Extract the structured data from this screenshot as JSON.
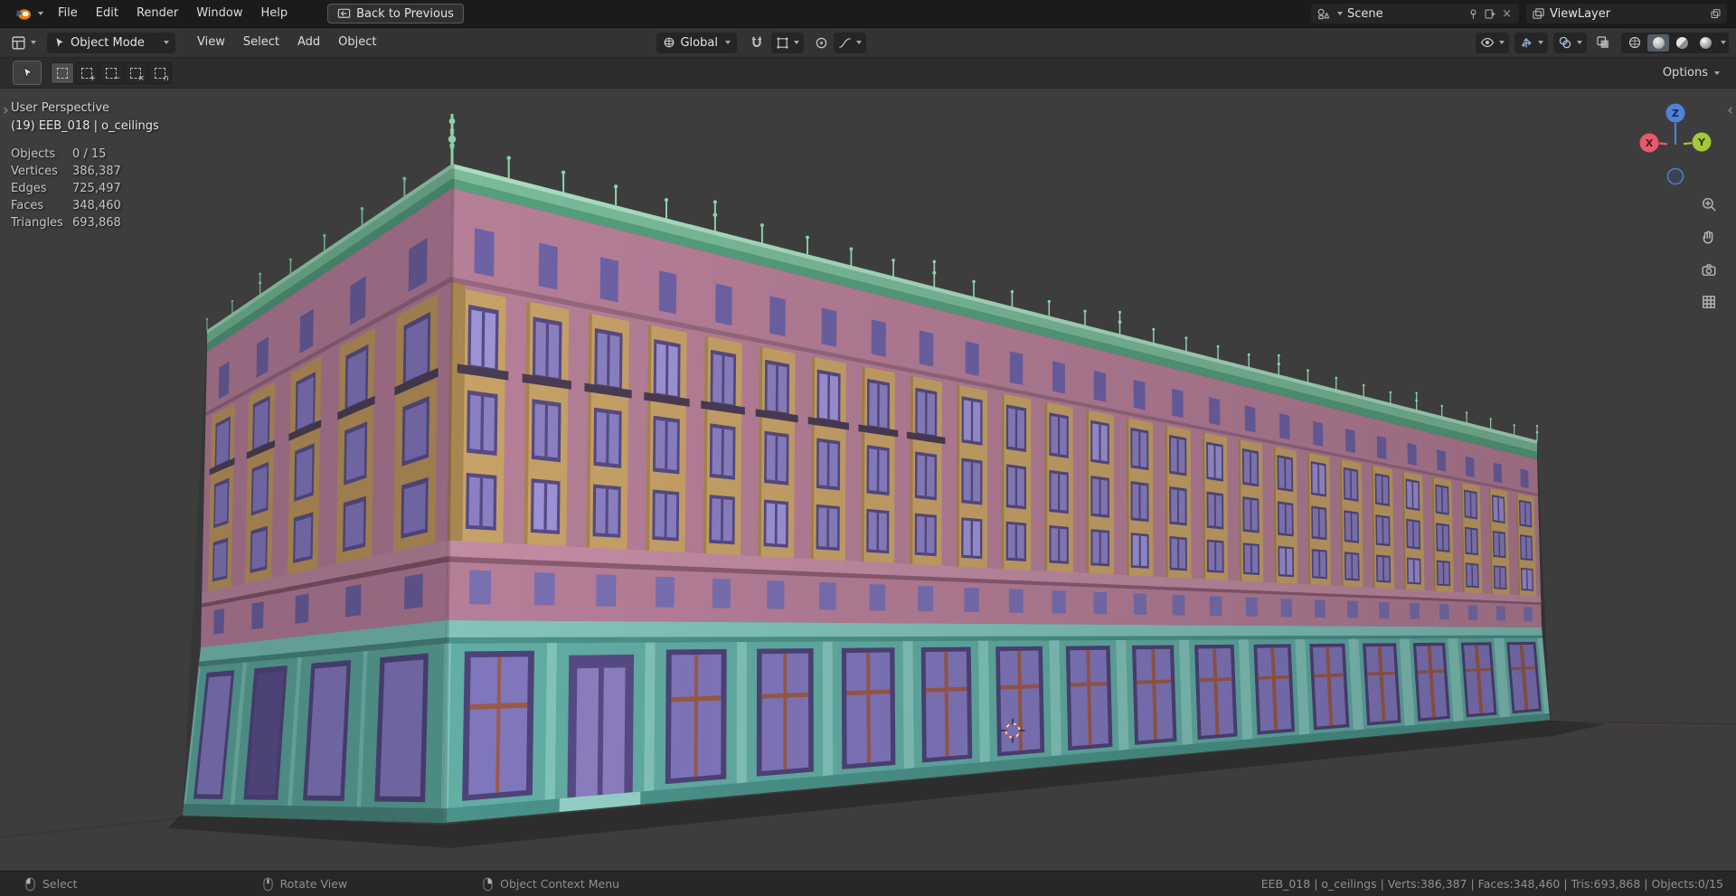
{
  "topbar": {
    "menus": [
      {
        "label": "File"
      },
      {
        "label": "Edit"
      },
      {
        "label": "Render"
      },
      {
        "label": "Window"
      },
      {
        "label": "Help"
      }
    ],
    "back_button": {
      "label": "Back to Previous"
    },
    "scene": {
      "value": "Scene"
    },
    "view_layer": {
      "value": "ViewLayer"
    }
  },
  "viewport_header": {
    "mode": {
      "value": "Object Mode"
    },
    "menus": [
      {
        "label": "View"
      },
      {
        "label": "Select"
      },
      {
        "label": "Add"
      },
      {
        "label": "Object"
      }
    ],
    "orientation": {
      "value": "Global"
    }
  },
  "tool_header": {
    "options_label": "Options"
  },
  "overlay": {
    "view_label": "User Perspective",
    "active_object": "(19) EEB_018 | o_ceilings",
    "stats": [
      {
        "label": "Objects",
        "value": "0 / 15"
      },
      {
        "label": "Vertices",
        "value": "386,387"
      },
      {
        "label": "Edges",
        "value": "725,497"
      },
      {
        "label": "Faces",
        "value": "348,460"
      },
      {
        "label": "Triangles",
        "value": "693,868"
      }
    ]
  },
  "gizmo": {
    "axes": [
      "X",
      "Y",
      "Z"
    ]
  },
  "statusbar": {
    "hints": [
      {
        "button": "left",
        "label": "Select"
      },
      {
        "button": "middle",
        "label": "Rotate View"
      },
      {
        "button": "right",
        "label": "Object Context Menu"
      }
    ],
    "info": "EEB_018 | o_ceilings | Verts:386,387 | Faces:348,460 | Tris:693,868 | Objects:0/15"
  },
  "icons": {
    "close": "×",
    "panel_toggle_left": "›",
    "panel_toggle_right": "‹"
  },
  "scene_colors": {
    "facade_pink": "#b67f98",
    "facade_pink_dark": "#96687e",
    "facade_side_pink": "#aa7690",
    "cornice_green": "#7abc99",
    "cornice_green_light": "#a9ddc1",
    "cornice_green_dark": "#55a07e",
    "panel_tan": "#c7a267",
    "panel_tan_dark": "#a9854f",
    "window_frame": "#564b84",
    "window_purple": "#8b80c2",
    "window_purple_light": "#9d93d6",
    "window_attic": "#6e63a6",
    "window_mezz": "#7b70b2",
    "balcony": "#493c53",
    "belt_pink": "#c38ca4",
    "belt_shadow": "#8a5c72",
    "ground_teal": "#62ada4",
    "ground_teal_light": "#82c4bb",
    "ground_teal_dark": "#4a938a",
    "shop_frame": "#4e4379",
    "shop_glass": "#8177bd",
    "mullion_rust": "#9c5a48",
    "door_purple": "#8d7fc0",
    "steps": "#95d1c8",
    "side_teal": "#579c93",
    "side_teal_light": "#6fb3aa",
    "side_teal_dark": "#437e76",
    "side_tan": "#b28d58",
    "side_attic": "#655a98",
    "side_window": "#7d72b5",
    "side_pink_dark": "#8d607a",
    "side_belt": "#b07e95",
    "side_belt_shadow": "#7a4f64",
    "side_cornice": "#6bae8c",
    "side_cornice_light": "#8fc7aa",
    "side_cornice_dark": "#4d9174",
    "finial": "#8ed0aa",
    "axis_x": "#e8596b",
    "axis_y": "#a2c83c",
    "axis_z": "#5181d8",
    "accent": "#4772b3"
  }
}
